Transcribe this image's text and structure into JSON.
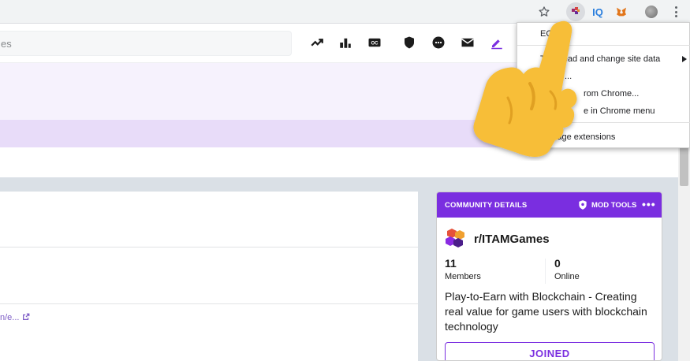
{
  "browser": {
    "icons": [
      "star-icon",
      "eos-extension-icon",
      "iq-extension-icon",
      "metamask-fox-icon",
      "profile-avatar",
      "chrome-menu-icon"
    ],
    "iq_label": "IQ"
  },
  "header": {
    "search_placeholder_visible": "es",
    "icons": [
      "trending-icon",
      "stats-icon",
      "closed-caption-icon",
      "shield-icon",
      "chat-icon",
      "mail-icon",
      "edit-icon"
    ]
  },
  "post": {
    "link_text": "n/e..."
  },
  "community": {
    "header_title": "COMMUNITY DETAILS",
    "mod_tools_label": "MOD TOOLS",
    "more_label": "•••",
    "name": "r/ITAMGames",
    "members_count": "11",
    "members_label": "Members",
    "online_count": "0",
    "online_label": "Online",
    "description": "Play-to-Earn with Blockchain - Creating real value for game users with blockchain technology",
    "joined_label": "JOINED"
  },
  "context_menu": {
    "item1": "EOS",
    "item2": "Th    n read and change site data",
    "item3": "...",
    "item4": "rom Chrome...",
    "item5": "e in Chrome menu",
    "item6": "Manage extensions"
  },
  "colors": {
    "reddit_purple": "#7a2ee0",
    "hand_yellow": "#f7be38"
  }
}
